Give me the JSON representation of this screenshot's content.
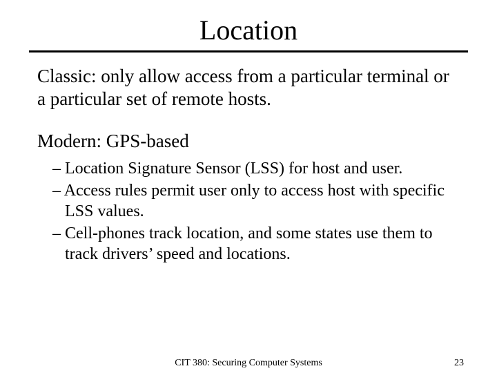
{
  "title": "Location",
  "para1": "Classic: only allow access from a particular terminal or a particular set of remote hosts.",
  "subheading": "Modern: GPS-based",
  "bullets": [
    "Location Signature Sensor (LSS) for host and user.",
    "Access rules permit user only to access host with specific LSS values.",
    "Cell-phones track location, and some states use them to track drivers’ speed and locations."
  ],
  "footer_center": "CIT 380: Securing Computer Systems",
  "footer_page": "23"
}
